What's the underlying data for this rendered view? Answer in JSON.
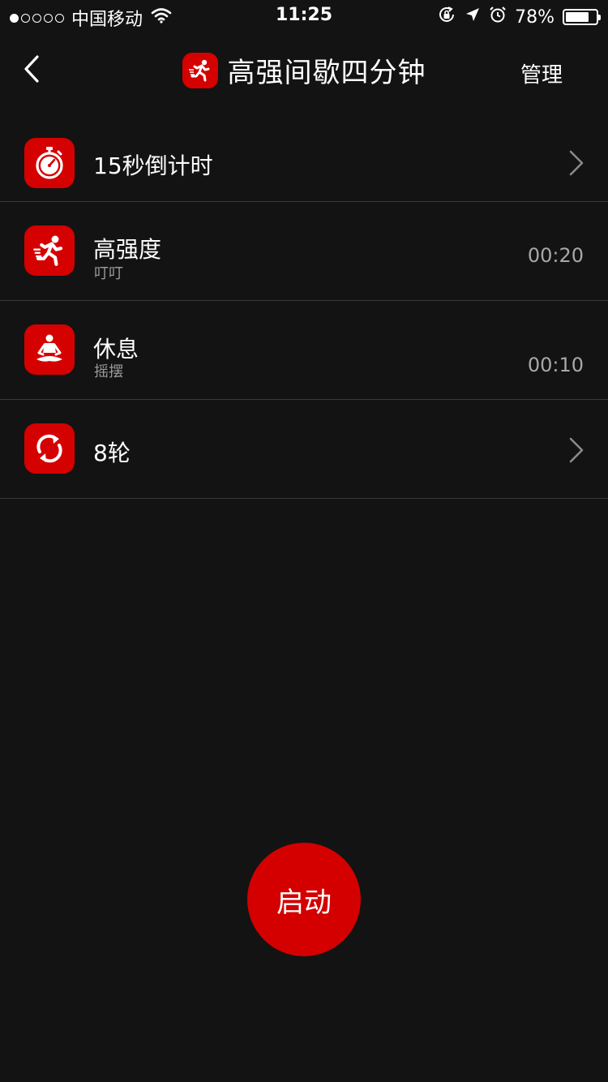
{
  "status": {
    "carrier": "中国移动",
    "time": "11:25",
    "battery": "78%",
    "battery_level": 0.78,
    "signal_bars": 1,
    "icons": [
      "wifi-icon",
      "rotation-lock-icon",
      "location-icon",
      "alarm-icon",
      "battery-icon"
    ]
  },
  "nav": {
    "title": "高强间歇四分钟",
    "right_label": "管理",
    "icons": [
      "back-chevron-icon",
      "running-man-icon"
    ]
  },
  "list": {
    "items": [
      {
        "label": "15秒倒计时",
        "icon": "stopwatch-icon"
      },
      {
        "label": "高强度",
        "sub": "叮叮",
        "time": "00:20",
        "icon": "running-man-icon"
      },
      {
        "label": "休息",
        "sub": "摇摆",
        "time": "00:10",
        "icon": "meditation-icon"
      },
      {
        "label": "8轮",
        "icon": "repeat-icon"
      }
    ]
  },
  "start": {
    "label": "启动"
  },
  "colors": {
    "accent": "#d50000",
    "background": "#131313",
    "divider": "#3a3a3a"
  }
}
